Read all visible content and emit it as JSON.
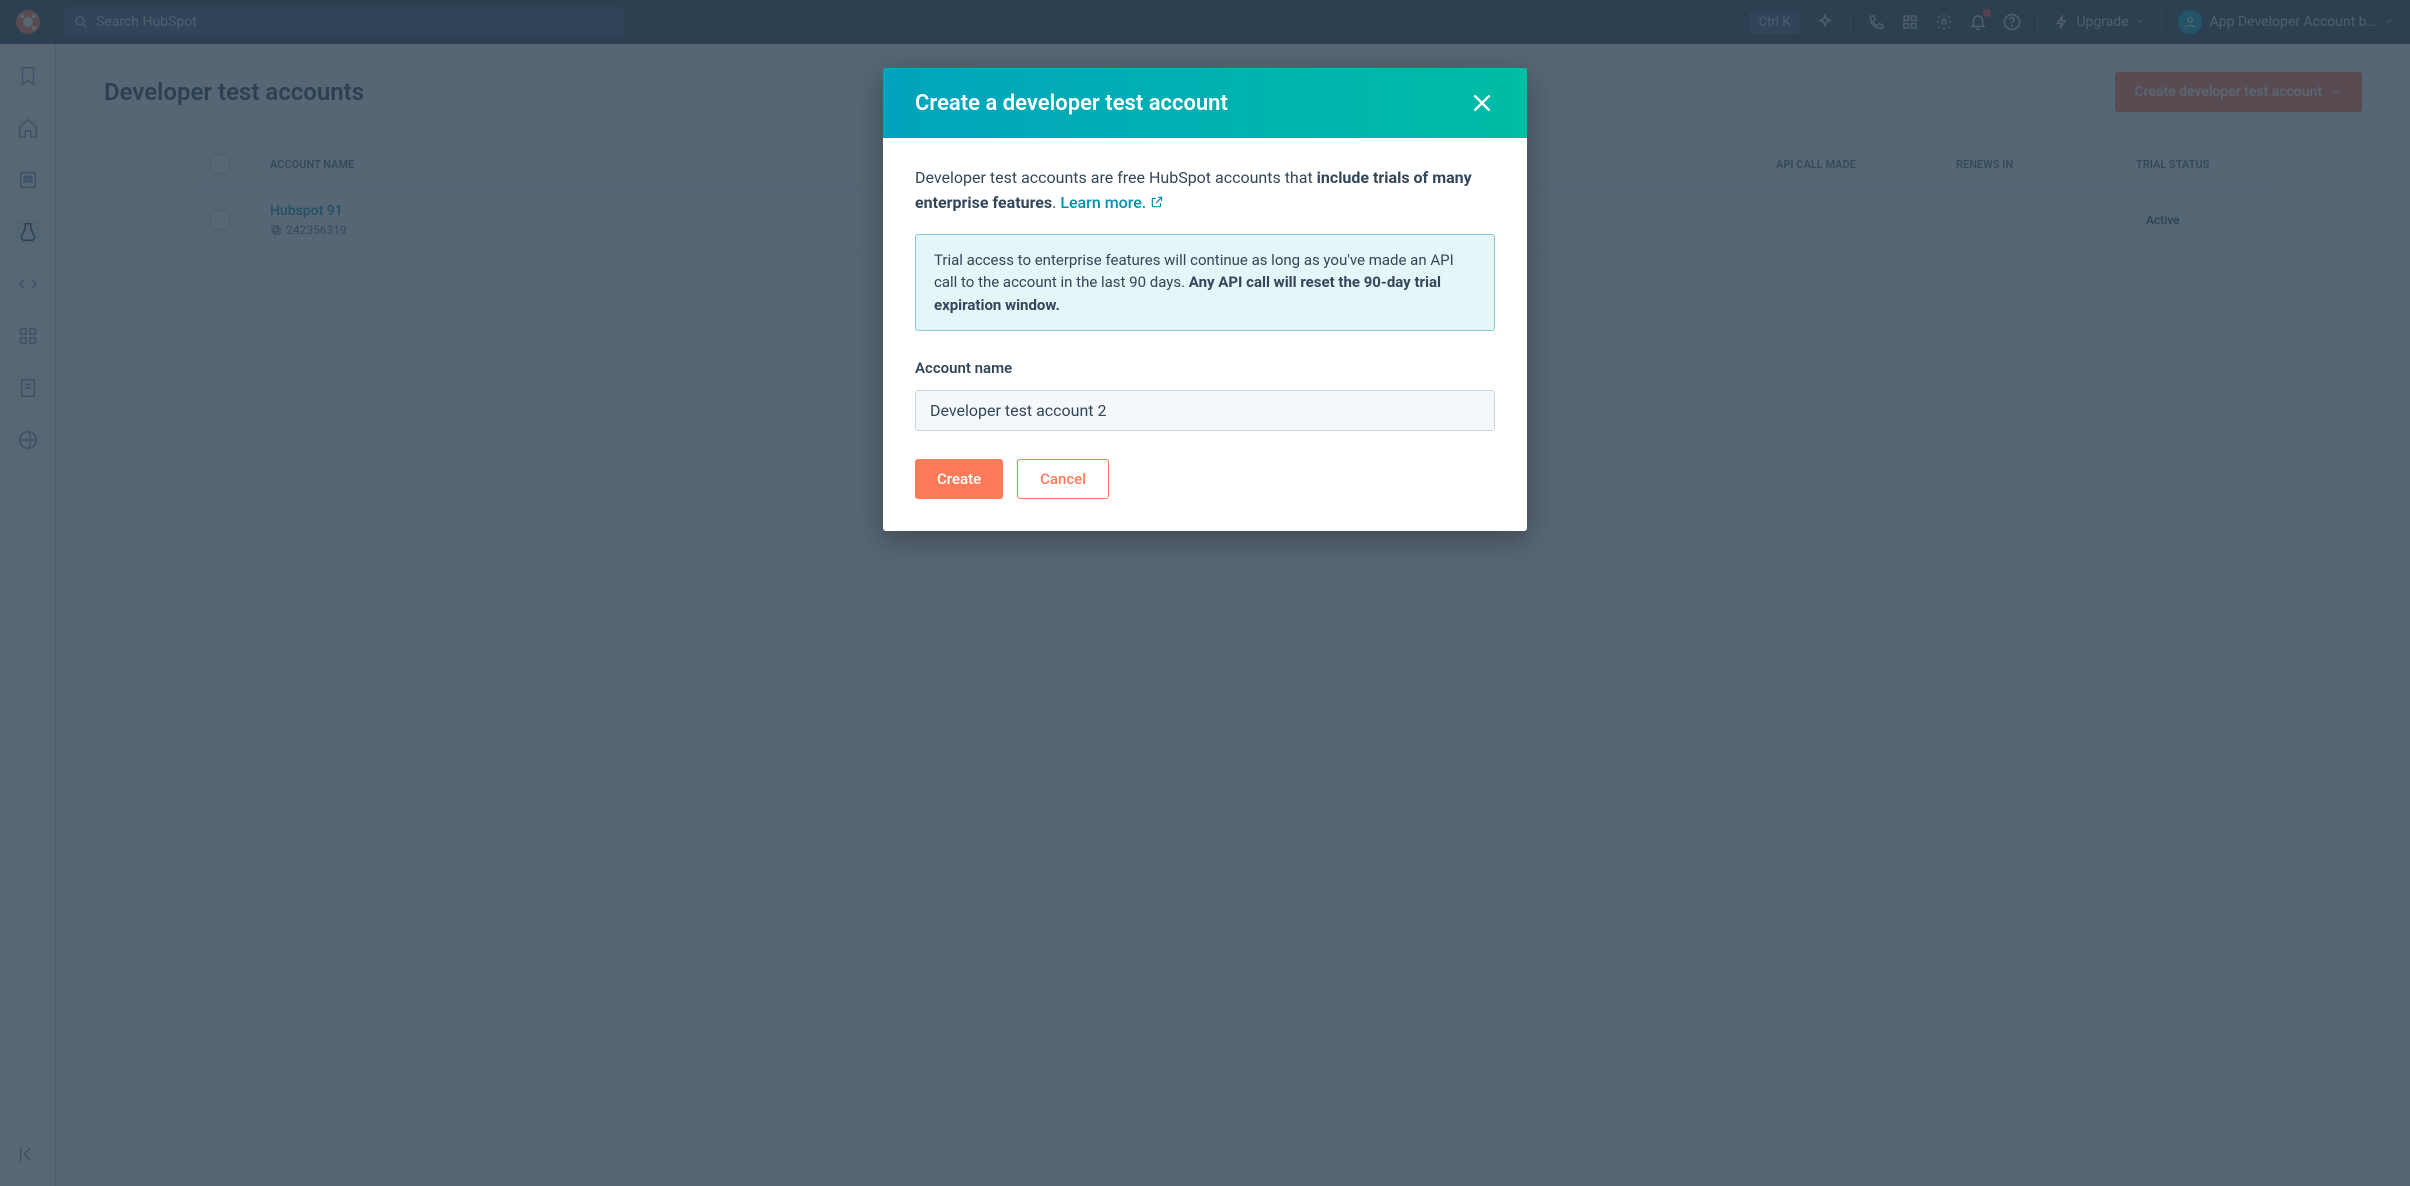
{
  "topnav": {
    "search_placeholder": "Search HubSpot",
    "ctrl_k": "Ctrl K",
    "upgrade": "Upgrade",
    "profile_name": "App Developer Account b…"
  },
  "page": {
    "title": "Developer test accounts",
    "create_btn": "Create developer test account"
  },
  "table": {
    "col_name": "ACCOUNT NAME",
    "col_cal": "API CALL MADE",
    "col_renew": "RENEWS IN",
    "col_status": "TRIAL STATUS",
    "rows": [
      {
        "name": "Hubspot 91",
        "id": "242356319",
        "cal": "",
        "renew": "",
        "status": "Active"
      }
    ]
  },
  "modal": {
    "title": "Create a developer test account",
    "intro_prefix": "Developer test accounts are free HubSpot accounts that ",
    "intro_bold": "include trials of many enterprise features",
    "intro_suffix": ". ",
    "learn_more": "Learn more.",
    "info_prefix": "Trial access to enterprise features will continue as long as you've made an API call to the account in the last 90 days. ",
    "info_bold": "Any API call will reset the 90-day trial expiration window.",
    "field_label": "Account name",
    "field_value": "Developer test account 2",
    "create": "Create",
    "cancel": "Cancel"
  }
}
